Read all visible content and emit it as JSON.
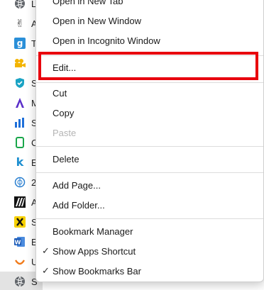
{
  "colors": {
    "highlight_border": "#e8000d",
    "menu_text": "#1a1a1a",
    "disabled_text": "#b4b4b4",
    "separator": "#dcdcdc"
  },
  "bookmarks_bar": {
    "items": [
      {
        "icon": "globe-icon",
        "label": "L"
      },
      {
        "icon": "peace-hand-icon",
        "label": "A"
      },
      {
        "icon": "g-square-icon",
        "label": "T"
      },
      {
        "icon": "camera-icon",
        "label": ""
      },
      {
        "icon": "shield-icon",
        "label": "S"
      },
      {
        "icon": "a-logo-icon",
        "label": "M"
      },
      {
        "icon": "bar-chart-icon",
        "label": "S"
      },
      {
        "icon": "phone-outline-icon",
        "label": "C"
      },
      {
        "icon": "k-letter-icon",
        "label": "E"
      },
      {
        "icon": "un-emblem-icon",
        "label": "2"
      },
      {
        "icon": "stripes-logo-icon",
        "label": "A"
      },
      {
        "icon": "x-yellow-icon",
        "label": "S"
      },
      {
        "icon": "word-icon",
        "label": "E"
      },
      {
        "icon": "swoosh-icon",
        "label": "U"
      },
      {
        "icon": "globe-icon",
        "label": "S"
      }
    ]
  },
  "context_menu": {
    "open_new_tab": "Open in New Tab",
    "open_new_window": "Open in New Window",
    "open_incognito": "Open in Incognito Window",
    "edit": "Edit...",
    "cut": "Cut",
    "copy": "Copy",
    "paste": "Paste",
    "delete": "Delete",
    "add_page": "Add Page...",
    "add_folder": "Add Folder...",
    "bookmark_manager": "Bookmark Manager",
    "show_apps_shortcut": "Show Apps Shortcut",
    "show_bookmarks_bar": "Show Bookmarks Bar",
    "checkmark": "✓"
  }
}
